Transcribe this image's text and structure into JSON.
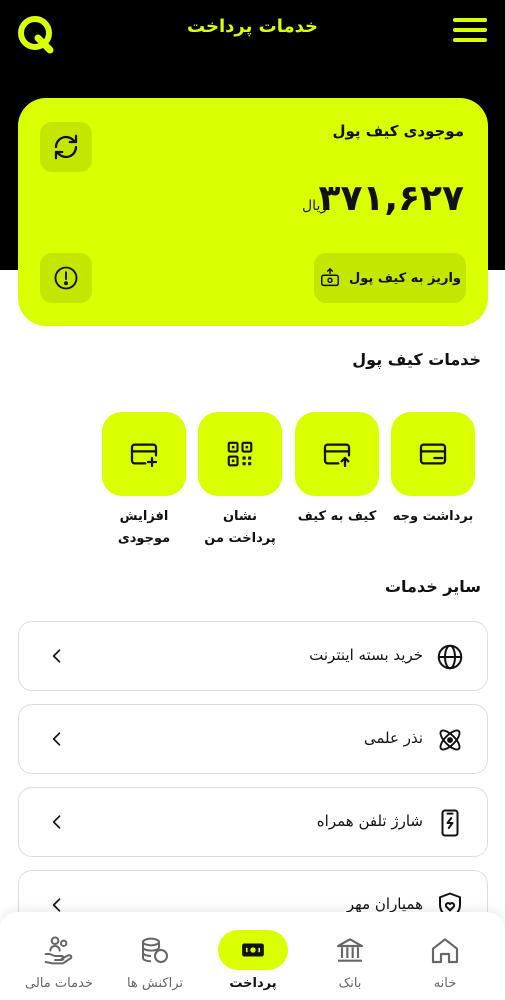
{
  "header": {
    "title": "خدمات پرداخت",
    "logo": "q-logo-icon",
    "menu_icon": "hamburger-menu-icon"
  },
  "wallet": {
    "title": "موجودی کیف پول",
    "amount": "۳۷۱,۶۲۷",
    "unit": "ریال",
    "deposit_label": "واریز به کیف پول",
    "refresh_icon": "refresh-icon",
    "info_icon": "info-icon"
  },
  "wallet_services": {
    "title": "خدمات کیف پول",
    "items": [
      {
        "label": "برداشت وجه",
        "icon": "card-minus-icon"
      },
      {
        "label": "کیف به کیف",
        "icon": "card-send-icon"
      },
      {
        "label": "نشان پرداخت من",
        "icon": "qr-code-icon"
      },
      {
        "label": "افزایش موجودی",
        "icon": "card-add-icon"
      }
    ]
  },
  "other_services": {
    "title": "سایر خدمات",
    "items": [
      {
        "label": "خرید بسته اینترنت",
        "icon": "globe-icon"
      },
      {
        "label": "نذر علمی",
        "icon": "atom-icon"
      },
      {
        "label": "شارژ تلفن همراه",
        "icon": "mobile-charge-icon"
      },
      {
        "label": "همیاران مهر",
        "icon": "shield-heart-icon"
      }
    ]
  },
  "nav": {
    "items": [
      {
        "label": "خانه",
        "icon": "home-icon"
      },
      {
        "label": "بانک",
        "icon": "bank-icon"
      },
      {
        "label": "پرداخت",
        "icon": "payment-icon"
      },
      {
        "label": "تراکنش ها",
        "icon": "coins-icon"
      },
      {
        "label": "خدمات مالی",
        "icon": "hand-people-icon"
      }
    ],
    "active_index": 2
  },
  "colors": {
    "accent": "#d9ff00",
    "accent_dark": "#c4e600",
    "background_dark": "#000000"
  }
}
